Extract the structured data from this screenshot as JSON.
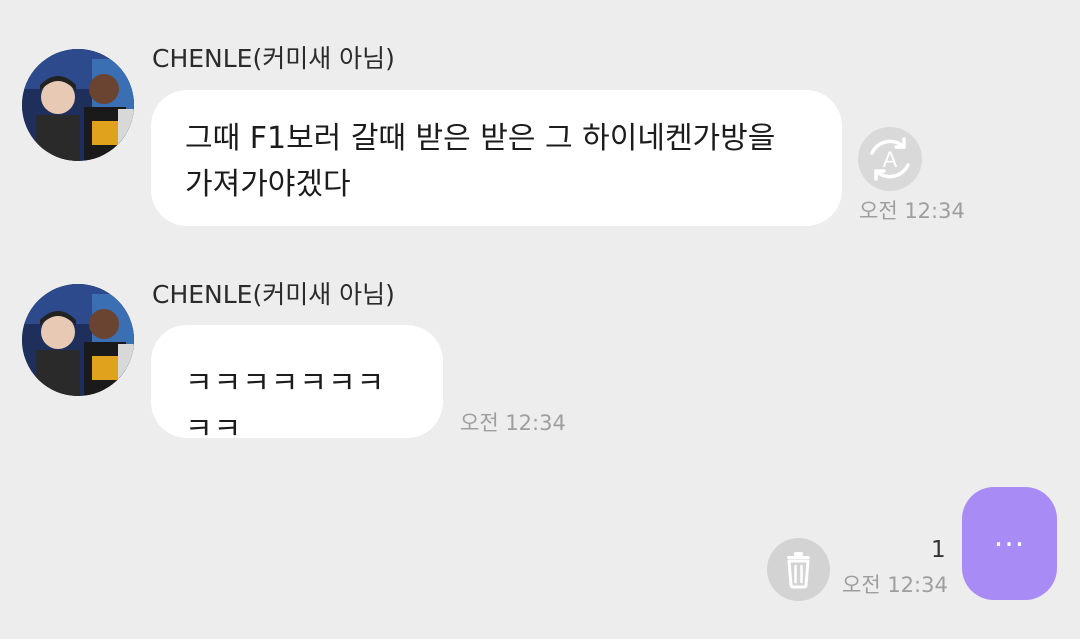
{
  "messages": [
    {
      "sender": "CHENLE(커미새 아님)",
      "lines": [
        "그때 F1보러 갈때 받은 받은 그 하이네켄가방을",
        "가져가야겠다"
      ],
      "time": "오전 12:34",
      "avatar_icon": "profile-photo"
    },
    {
      "sender": "CHENLE(커미새 아님)",
      "text": "ㅋㅋㅋㅋㅋㅋㅋㅋㅋ",
      "time": "오전 12:34",
      "avatar_icon": "profile-photo"
    }
  ],
  "my_message": {
    "text": "...",
    "unread_count": "1",
    "time": "오전 12:34"
  },
  "icons": {
    "translate": "translate-icon",
    "delete": "trash-icon"
  },
  "colors": {
    "background": "#ededed",
    "incoming_bubble": "#ffffff",
    "outgoing_bubble": "#a98bf5",
    "timestamp": "#9e9e9e"
  }
}
